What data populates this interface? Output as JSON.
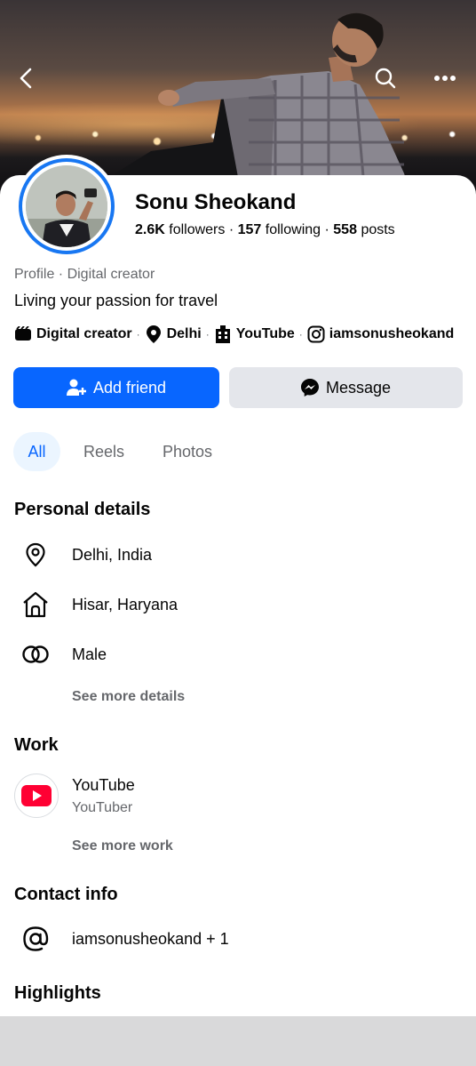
{
  "cover": {
    "photo_subject": "man sitting against city lights at dusk"
  },
  "header": {
    "back_icon": "chevron-left-icon",
    "search_icon": "search-icon",
    "more_icon": "more-horizontal-icon"
  },
  "profile": {
    "name": "Sonu Sheokand",
    "followers_count": "2.6K",
    "followers_label": "followers",
    "following_count": "157",
    "following_label": "following",
    "posts_count": "558",
    "posts_label": "posts",
    "category_line": "Profile · Digital creator",
    "bio": "Living your passion for travel",
    "tags": {
      "category": "Digital creator",
      "location": "Delhi",
      "work": "YouTube",
      "instagram": "iamsonusheokand"
    }
  },
  "actions": {
    "add_friend": "Add friend",
    "message": "Message"
  },
  "tabs": [
    "All",
    "Reels",
    "Photos"
  ],
  "personal_details": {
    "title": "Personal details",
    "items": [
      "Delhi, India",
      "Hisar, Haryana",
      "Male"
    ],
    "see_more": "See more details"
  },
  "work": {
    "title": "Work",
    "company": "YouTube",
    "role": "YouTuber",
    "see_more": "See more work"
  },
  "contact": {
    "title": "Contact info",
    "value": "iamsonusheokand + 1"
  },
  "highlights": {
    "title": "Highlights"
  },
  "colors": {
    "accent": "#0866ff",
    "secondary_button": "#e4e6eb",
    "muted_text": "#65676b",
    "youtube_red": "#ff0033"
  }
}
